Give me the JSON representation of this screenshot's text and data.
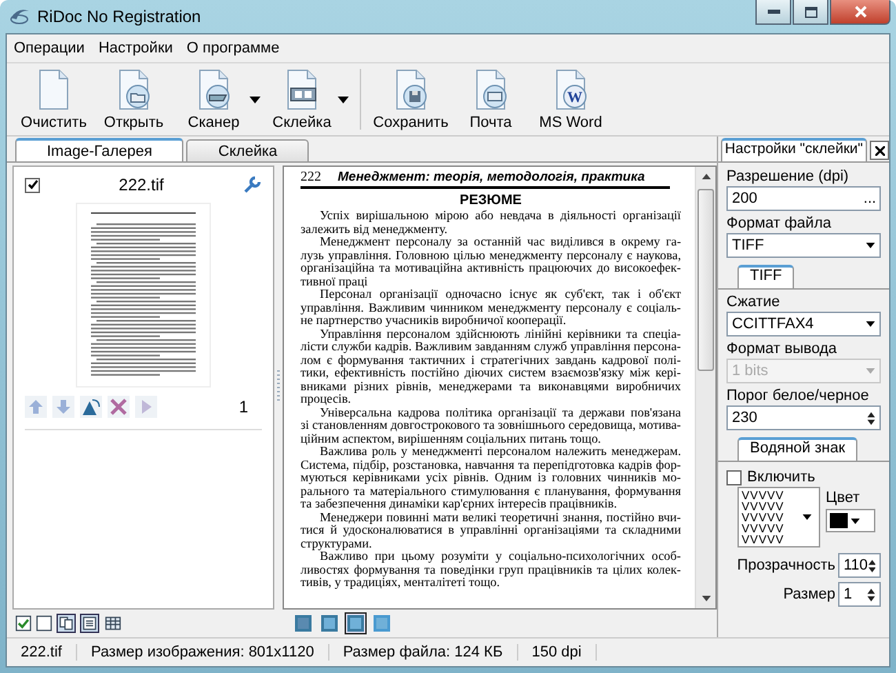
{
  "window": {
    "title": "RiDoc No Registration"
  },
  "menu": [
    "Операции",
    "Настройки",
    "О программе"
  ],
  "toolbar": [
    {
      "kind": "button",
      "label": "Очистить"
    },
    {
      "kind": "button",
      "label": "Открыть"
    },
    {
      "kind": "split",
      "label": "Сканер"
    },
    {
      "kind": "split",
      "label": "Склейка"
    },
    {
      "kind": "separator"
    },
    {
      "kind": "button",
      "label": "Сохранить"
    },
    {
      "kind": "button",
      "label": "Почта"
    },
    {
      "kind": "button",
      "label": "MS Word",
      "glyph": "W"
    }
  ],
  "tabs": [
    {
      "label": "Image-Галерея",
      "selected": true
    },
    {
      "label": "Склейка",
      "selected": false
    }
  ],
  "gallery": {
    "items": [
      {
        "name": "222.tif",
        "checked": true,
        "page": "1"
      }
    ],
    "tools": [
      {
        "selected": true
      },
      {
        "selected": true
      },
      {
        "selected": false
      }
    ]
  },
  "document": {
    "page_number": "222",
    "running_head": "Менеджмент: теорія, методологія, практика",
    "heading": "РЕЗЮМЕ",
    "paragraphs": [
      {
        "lines": [
          "Успіх вирішальною мірою або невдача в діяльності організації",
          "залежить від менеджменту."
        ]
      },
      {
        "lines": [
          "Менеджмент персоналу за останній час виділився в окрему га-",
          "лузь управління. Головною цілью менеджменту персоналу є наукова,",
          "організаційна та мотиваційна активність працюючих до високоефек-",
          "тивної праці"
        ]
      },
      {
        "lines": [
          "Персонал організації одночасно існує як суб'єкт, так і об'єкт",
          "управління. Важливим чинником менеджменту персоналу є соціаль-",
          "не партнерство учасників виробничої кооперації."
        ]
      },
      {
        "lines": [
          "Управління персоналом здійснюють лінійні керівники та спеціа-",
          "лісти служби кадрів. Важливим завданням служб управління персона-",
          "лом є формування тактичних і стратегічних завдань кадрової полі-",
          "тики, ефективність постійно діючих систем взаємозв'язку між кері-",
          "вниками різних рівнів, менеджерами та виконавцями виробничих",
          "процесів."
        ]
      },
      {
        "lines": [
          "Універсальна кадрова політика організації та держави пов'язана",
          "зі становленням довгострокового та зовнішнього середовища, мотива-",
          "ційним аспектом, вирішенням соціальних питань тощо."
        ]
      },
      {
        "lines": [
          "Важлива роль у менеджменті персоналом належить менеджерам.",
          "Система, підбір, розстановка, навчання та перепідготовка кадрів фор-",
          "муються керівниками усіх рівнів. Одним із головних чинників мо-",
          "рального та матеріального стимулювання є планування, формування",
          "та забезпечення динаміки кар'єрних інтересів працівників."
        ]
      },
      {
        "lines": [
          "Менеджери повинні мати великі теоретичні знання, постійно вчи-",
          "тися й удосконалюватися в управлінні організаціями та складними",
          "структурами."
        ]
      },
      {
        "lines": [
          "Важливо при цьому розуміти у соціально-психологічних особ-",
          "ливостях формування та поведінки груп працівників та цілих колек-",
          "тивів, у традиціях, менталітеті тощо."
        ]
      }
    ]
  },
  "view_modes": [
    {
      "selected": false
    },
    {
      "selected": false
    },
    {
      "selected": true
    },
    {
      "selected": false
    }
  ],
  "settings": {
    "tab": "Настройки \"склейки\"",
    "resolution_label": "Разрешение (dpi)",
    "resolution": "200",
    "browse": "...",
    "format_label": "Формат файла",
    "format": "TIFF",
    "subtab": "TIFF",
    "compression_label": "Сжатие",
    "compression": "CCITTFAX4",
    "output_label": "Формат вывода",
    "output": "1 bits",
    "output_disabled": true,
    "threshold_label": "Порог белое/черное",
    "threshold": "230",
    "watermark_tab": "Водяной знак",
    "enable_label": "Включить",
    "enabled": false,
    "pattern": [
      "VVVVV",
      "VVVVV",
      "VVVVV",
      "VVVVV",
      "VVVVV"
    ],
    "color_label": "Цвет",
    "color": "#000000",
    "opacity_label": "Прозрачность",
    "opacity": "110",
    "size_label": "Размер",
    "size": "1"
  },
  "status_bar": [
    "222.tif",
    "Размер изображения: 801x1120",
    "Размер файла: 124 КБ",
    "150 dpi"
  ]
}
